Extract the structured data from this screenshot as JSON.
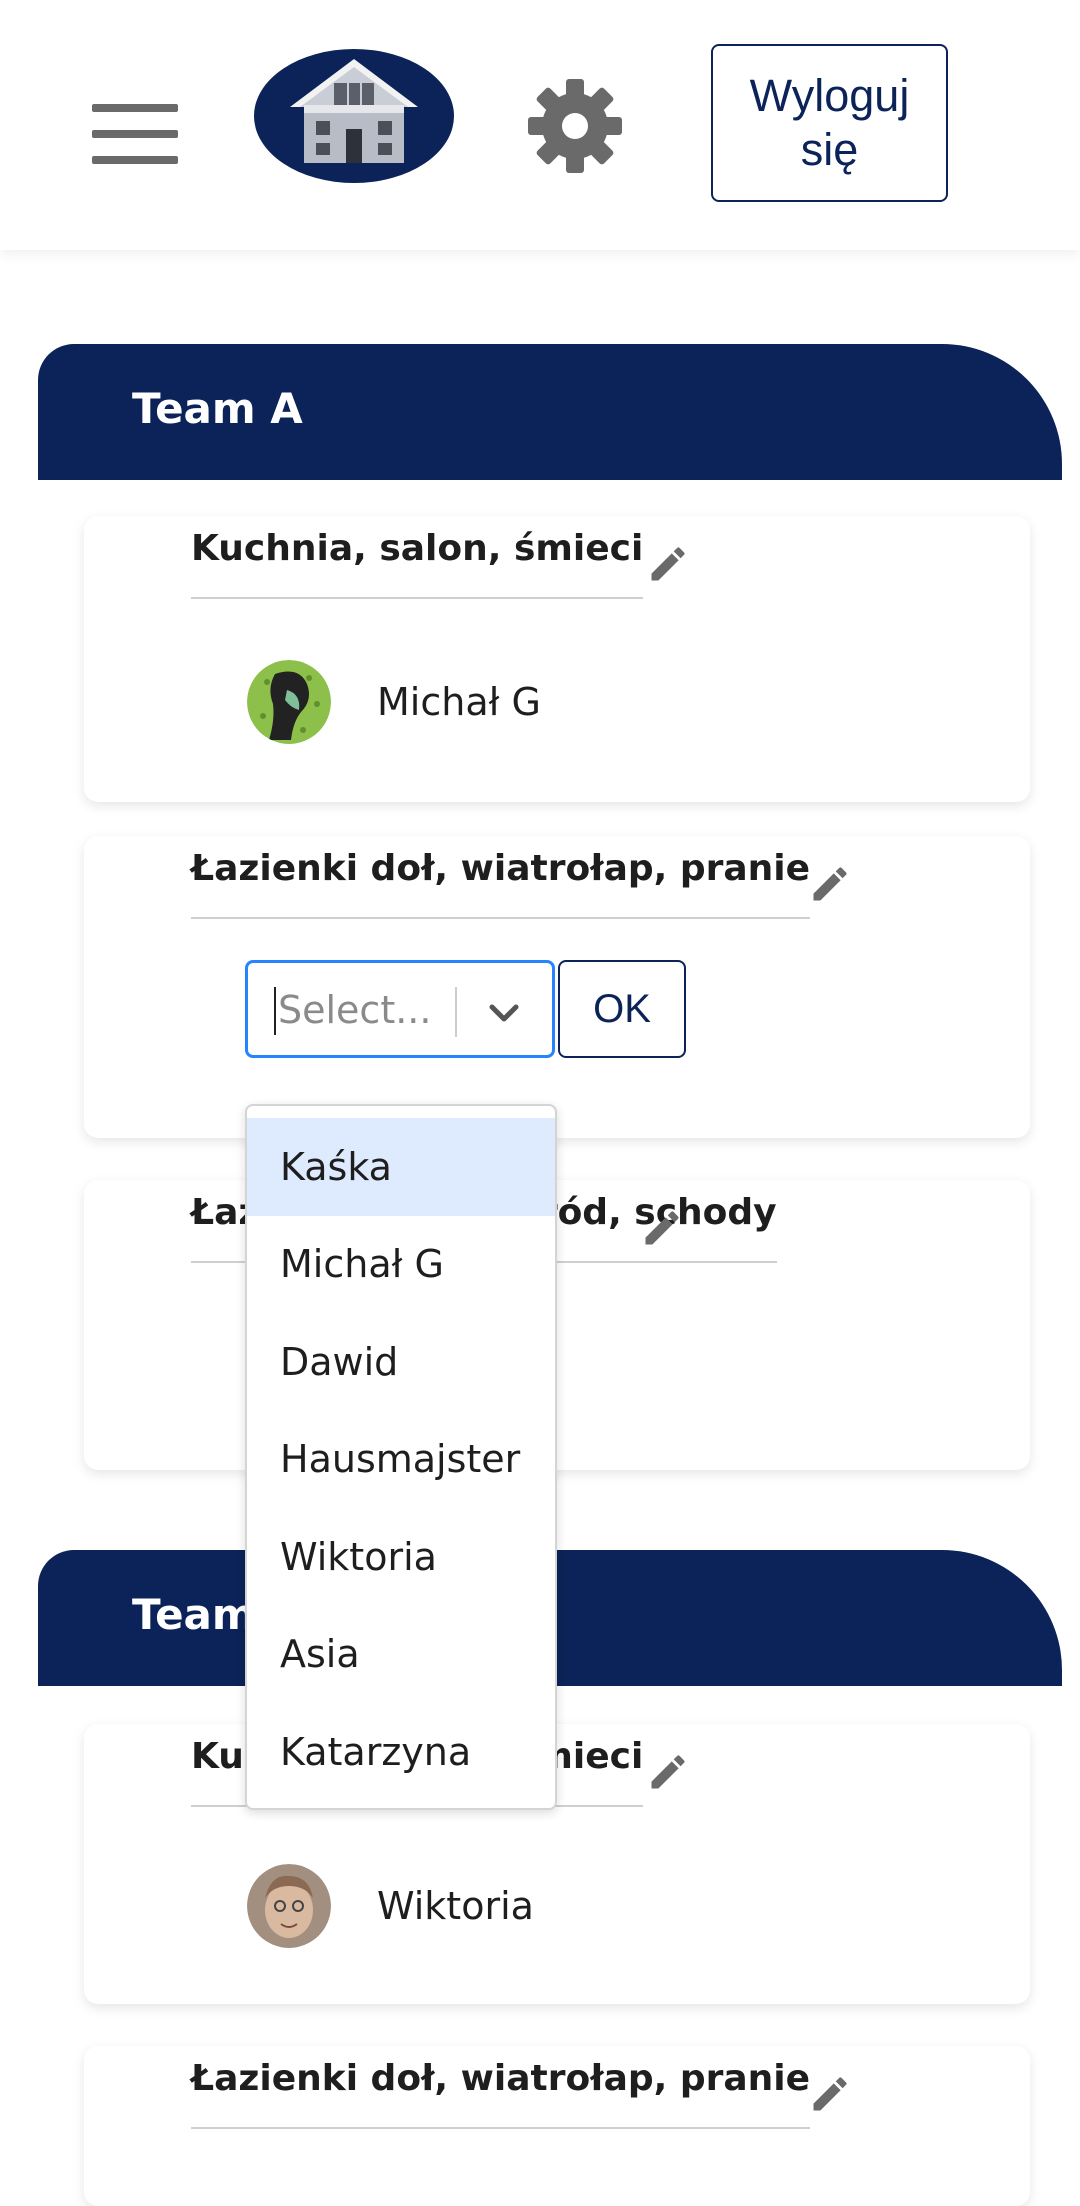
{
  "header": {
    "logout_label": "Wyloguj\nsię",
    "icons": {
      "menu": "hamburger-menu-icon",
      "logo": "house-logo",
      "settings": "gear-icon"
    },
    "colors": {
      "navy": "#0b2358",
      "icon_gray": "#6a6a6a"
    }
  },
  "teams": [
    {
      "title": "Team A",
      "tasks": [
        {
          "title": "Kuchnia, salon, śmieci",
          "member": "Michał G"
        },
        {
          "title": "Łazienki doł, wiatrołap, pranie",
          "select_placeholder": "Select...",
          "ok_label": "OK"
        },
        {
          "title": "Łazienki góra, ogród, schody"
        }
      ]
    },
    {
      "title": "Team B",
      "tasks": [
        {
          "title": "Kuchnia, salon, śmieci",
          "member": "Wiktoria"
        },
        {
          "title": "Łazienki doł, wiatrołap, pranie"
        }
      ]
    }
  ],
  "dropdown": {
    "options": [
      "Kaśka",
      "Michał G",
      "Dawid",
      "Hausmajster",
      "Wiktoria",
      "Asia",
      "Katarzyna"
    ],
    "highlighted": "Kaśka",
    "highlight_color": "#deebff"
  }
}
